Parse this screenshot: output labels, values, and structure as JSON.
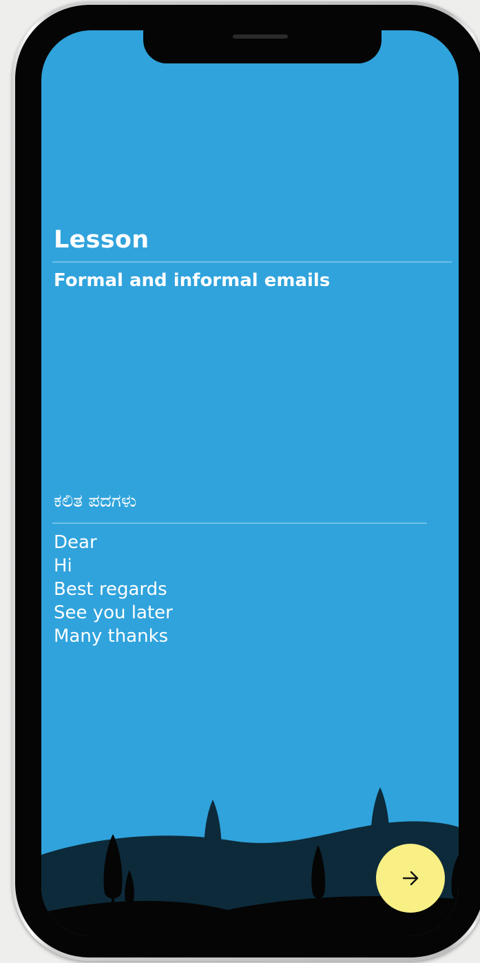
{
  "lesson": {
    "heading": "Lesson",
    "title": "Formal and informal emails"
  },
  "vocabulary": {
    "heading": "ಕಲಿತ ಪದಗಳು",
    "words": [
      "Dear",
      "Hi",
      "Best regards",
      "See you later",
      "Many thanks"
    ]
  },
  "next_button": {
    "icon": "arrow-right-icon"
  },
  "colors": {
    "background": "#30a3dc",
    "hills_far": "#0d2a3a",
    "hills_near": "#050505",
    "button": "#f8f085"
  }
}
